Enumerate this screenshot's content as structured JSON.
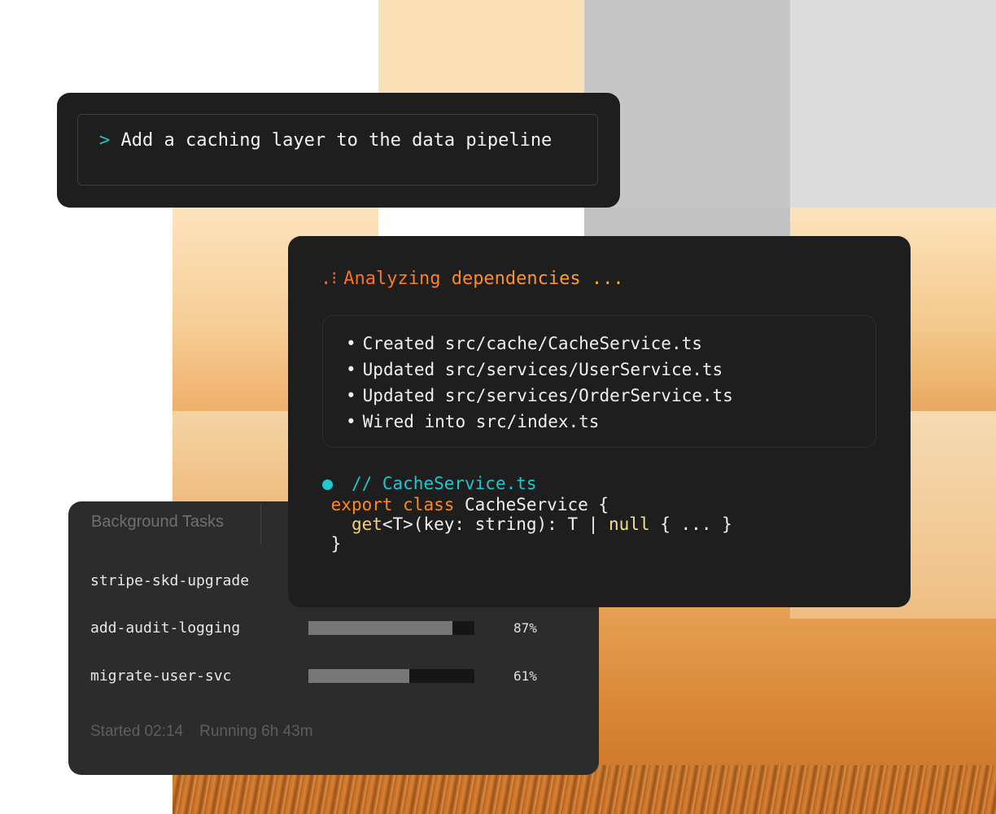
{
  "prompt": {
    "caret": ">",
    "text": "Add a caching layer to the data pipeline"
  },
  "analysis": {
    "status_icon": ".⁝",
    "status_text": "Analyzing dependencies ...",
    "changes": [
      "Created src/cache/CacheService.ts",
      "Updated src/services/UserService.ts",
      "Updated src/services/OrderService.ts",
      "Wired into src/index.ts"
    ],
    "code": {
      "comment": "// CacheService.ts",
      "line1_kw": "export class",
      "line1_rest": "CacheService {",
      "line2_fn": "get",
      "line2_mid": "<T>(key: string): T | ",
      "line2_null": "null",
      "line2_end": " { ... }",
      "line3": "}"
    }
  },
  "tasks": {
    "tab_label": "Background Tasks",
    "items": [
      {
        "name": "stripe-skd-upgrade",
        "progress": null,
        "percent": ""
      },
      {
        "name": "add-audit-logging",
        "progress": 0.87,
        "percent": "87%"
      },
      {
        "name": "migrate-user-svc",
        "progress": 0.61,
        "percent": "61%"
      }
    ],
    "footer_started": "Started 02:14",
    "footer_running": "Running 6h 43m"
  },
  "colors": {
    "accent_cyan": "#1fc9d1",
    "accent_orange": "#ff8a1f",
    "card_bg": "#1e1e1e",
    "panel_bg": "#2c2c2c"
  }
}
